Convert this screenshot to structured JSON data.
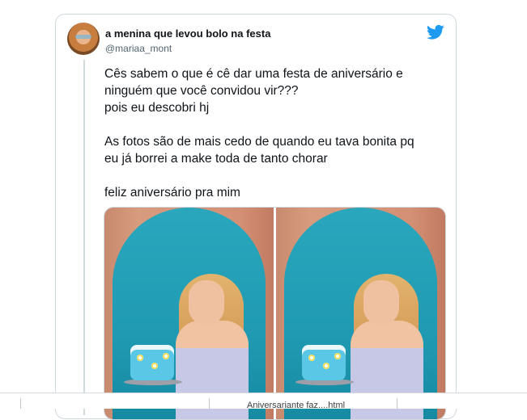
{
  "tweet": {
    "display_name": "a menina que levou bolo na festa",
    "handle": "@mariaa_mont",
    "paragraphs": [
      [
        "Cês sabem o que é cê dar uma festa de aniversário e",
        "ninguém que você convidou vir???",
        "pois eu descobri hj"
      ],
      [
        "As fotos são de mais cedo de quando eu tava bonita pq",
        "eu já borrei a make toda de tanto chorar"
      ],
      [
        "feliz aniversário pra mim"
      ]
    ],
    "brand_icon": "twitter-bird-icon",
    "brand_color": "#1d9bf0"
  },
  "taskbar": {
    "file_label": "Aniversariante faz....html"
  }
}
